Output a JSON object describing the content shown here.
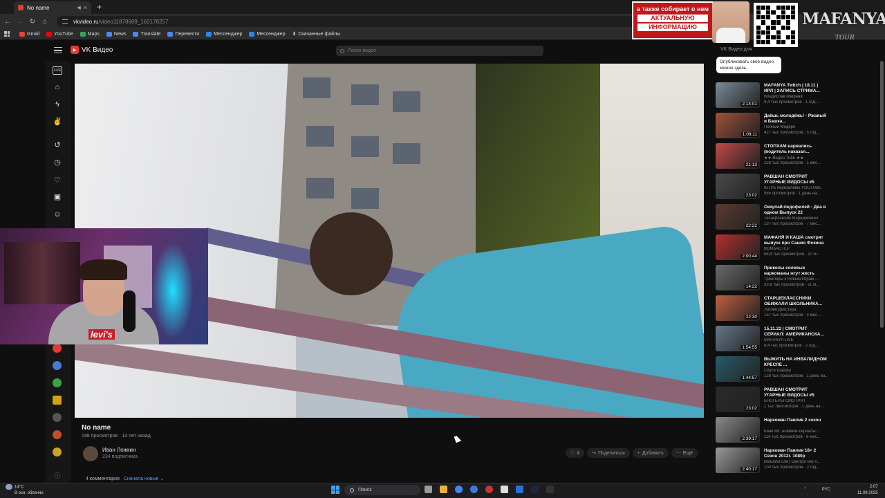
{
  "browser": {
    "tab_title": "No name",
    "new_tab": "+",
    "tab_close": "×",
    "url_domain": "vkvideo.ru",
    "url_path": "/video11878669_163178257",
    "bookmarks": [
      "Gmail",
      "YouTube",
      "Maps",
      "News",
      "Translate",
      "Перевести",
      "Мессенджер",
      "Мессенджер",
      "Скачанные файлы"
    ]
  },
  "overlay": {
    "promo_line1": "а также собирает о нем",
    "promo_line2": "АКТУАЛЬНУЮ",
    "promo_line3": "ИНФОРМАЦИЮ",
    "brand": "MAFANYA",
    "brand_sub": "TOUR"
  },
  "vk": {
    "logo": "VK Видео",
    "search_placeholder": "Поиск видео",
    "vk_for": "VK Видео для",
    "tooltip": "Опубликовать своё видео можно здесь",
    "sidebar_live": "LIVE"
  },
  "video": {
    "title": "No name",
    "views": "198 просмотров",
    "age": "13 лет назад",
    "channel": "Иван Ложкин",
    "subscribers": "234 подписчика",
    "likes": "4",
    "share": "Поделиться",
    "add": "Добавить",
    "more": "Ещё",
    "comments": "4 комментария",
    "sort": "Сначала новые"
  },
  "recommendations": [
    {
      "title": "MAFANYA Twitch | 18.11 | ИРЛ | ЗАПИСЬ СТРИМА...",
      "author": "Владислав Мафаня",
      "views": "9,4 тыс просмотров · 1 год...",
      "duration": "2:14:01",
      "color": "#7b8a9a"
    },
    {
      "title": "Даёшь молодёжь! - Ржавый и Башка...",
      "author": "Полный Модерн",
      "views": "427 тыс просмотров · 5 год...",
      "duration": "1:09:11",
      "color": "#a0503a"
    },
    {
      "title": "СТОПХАМ нарвались (водитель наказал...",
      "author": "★★ Видео Tube ★★",
      "views": "228 тыс просмотров · 1 мес...",
      "duration": "21:13",
      "color": "#c04848"
    },
    {
      "title": "РАВШАН СМОТРИТ УГАРНЫЕ ВИДОСЫ #5",
      "author": "ЮТУБ перезаливы YOUTUBE",
      "views": "985 просмотров · 1 день на...",
      "duration": "23:02",
      "color": "#4a4a4a"
    },
    {
      "title": "Оккупай-педофилей - Два в одном Выпуск 22",
      "author": "Тесак|Максим Марцинкевич",
      "views": "137 тыс просмотров · 7 мес...",
      "duration": "22:22",
      "color": "#5a3a30"
    },
    {
      "title": "МАФАНЯ И КАША смотрят выпуск про Сашко Фокина",
      "author": "ВОМБАСТЕР",
      "views": "68,8 тыс просмотров · 10 м...",
      "duration": "2:00:44",
      "color": "#b23030"
    },
    {
      "title": "Приколы солевые наркоманы жгут жесть",
      "author": "Трейлеры к Новым Играм ...",
      "views": "33,8 тыс просмотров · 11 м...",
      "duration": "14:22",
      "color": "#6a6a6a"
    },
    {
      "title": "СТАРШЕКЛАССНИКИ ОБИЖАЛИ ШКОЛЬНИКА...",
      "author": "Логово Декстера",
      "views": "137 тыс просмотров · 4 мес...",
      "duration": "22:30",
      "color": "#c06040"
    },
    {
      "title": "15.11.22 | СМОТРИТ СЕРИАЛ: АМЕРИКАНСКА...",
      "author": "MAFANYA LIVE",
      "views": "8,4 тыс просмотров · 2 год...",
      "duration": "1:54:55",
      "color": "#667788"
    },
    {
      "title": "ВЫЖИТЬ НА ИНВАЛИДНОМ КРЕСЛЕ ...",
      "author": "Спуся Шарфа",
      "views": "128 тыс просмотров · 1 день на...",
      "duration": "1:44:57",
      "color": "#2a5a6a"
    },
    {
      "title": "РАВШАН СМОТРИТ УГАРНЫЕ ВИДОСЫ #5",
      "author": "БЛОГЕРЫ СМОТРЯТ",
      "views": "1 тыс просмотров · 1 день на...",
      "duration": "23:02",
      "color": "#2a2a2a"
    },
    {
      "title": "Наркоман Павлик 2 сезон",
      "author": "Кино ВК: новинки-сериалы...",
      "views": "116 тыс просмотров · 8 мес...",
      "duration": "2:39:17",
      "color": "#8a8a8a"
    },
    {
      "title": "Наркоман Павлик 18+ 2 Сезон 2012г. 1080р",
      "author": "Beautiful Life | Смотри без п...",
      "views": "100 тыс просмотров · 2 год...",
      "duration": "2:40:17",
      "color": "#9a9a9a"
    }
  ],
  "taskbar": {
    "temp": "14°C",
    "weather": "В осн. облачно",
    "search": "Поиск",
    "lang": "РУС",
    "time": "2:07",
    "date": "11.09.2025"
  }
}
